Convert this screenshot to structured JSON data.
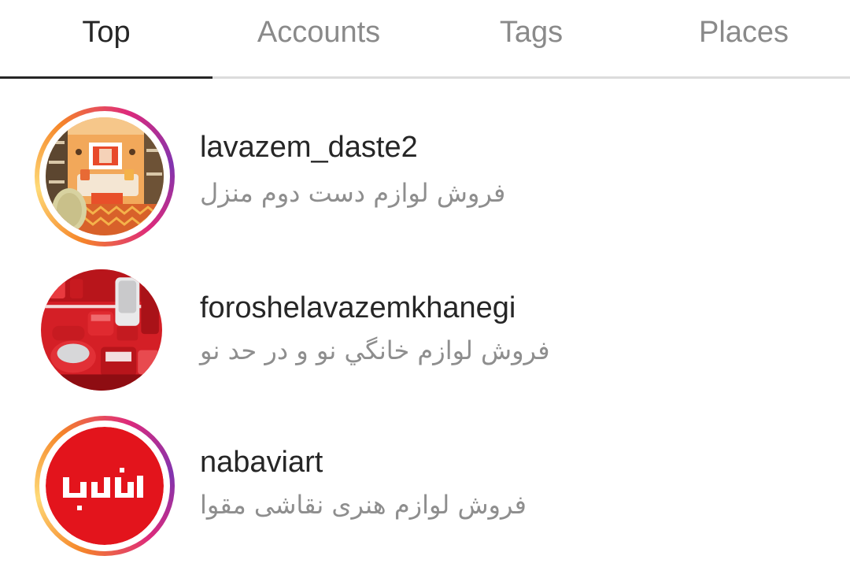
{
  "tabs": [
    {
      "label": "Top",
      "active": true
    },
    {
      "label": "Accounts",
      "active": false
    },
    {
      "label": "Tags",
      "active": false
    },
    {
      "label": "Places",
      "active": false
    }
  ],
  "results": [
    {
      "username": "lavazem_daste2",
      "subtitle": "فروش لوازم دست دوم منزل",
      "avatar_icon": "living-room-photo",
      "has_story_ring": true
    },
    {
      "username": "foroshelavazemkhanegi",
      "subtitle": "فروش لوازم خانگي نو و در حد نو",
      "avatar_icon": "red-kitchen-appliances-photo",
      "has_story_ring": false
    },
    {
      "username": "nabaviart",
      "subtitle": "فروش لوازم هنری نقاشی مقوا",
      "avatar_icon": "nabavi-art-logo",
      "avatar_logo_text": "نبوی آرت",
      "has_story_ring": true
    }
  ],
  "colors": {
    "active_tab_text": "#262626",
    "inactive_tab_text": "#8a8a8a",
    "subtitle_text": "#8e8e8e",
    "story_ring_start": "#f58529",
    "story_ring_end": "#dd2a7b",
    "logo_red": "#e3141c"
  }
}
